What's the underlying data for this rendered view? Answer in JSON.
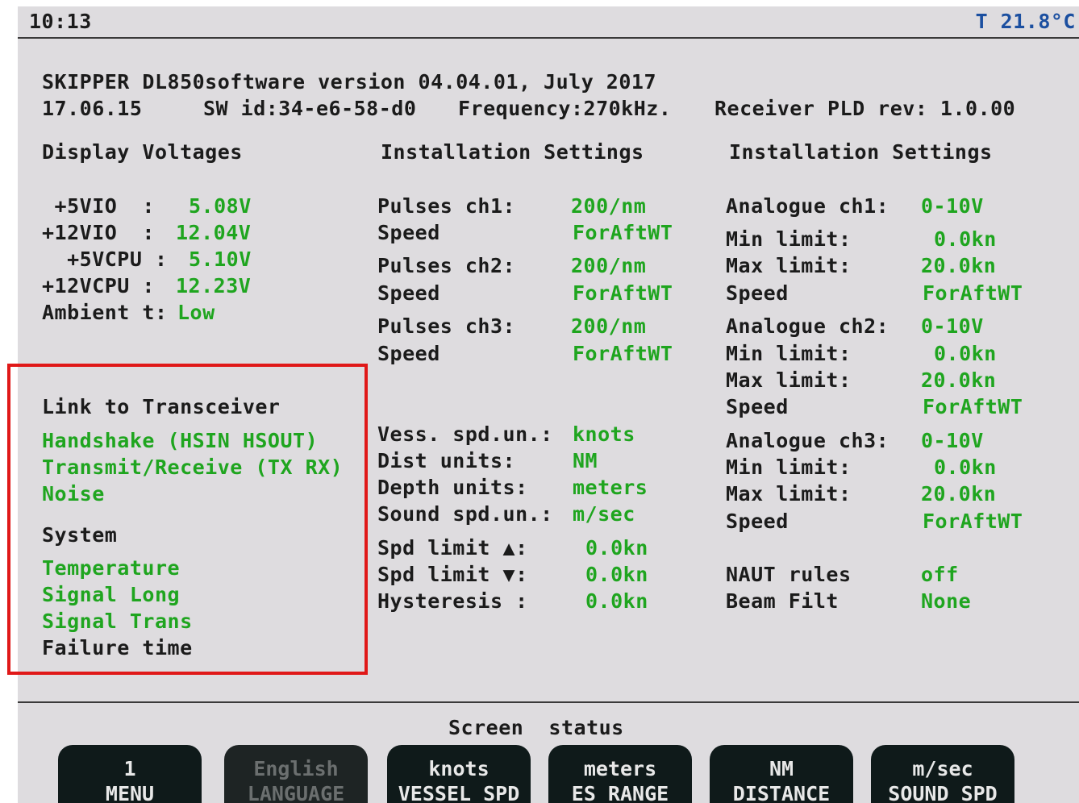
{
  "topbar": {
    "time": "10:13",
    "temperature": "T 21.8°C"
  },
  "header": {
    "line1": "SKIPPER DL850software version 04.04.01, July 2017",
    "line2_date": "17.06.15",
    "line2_swid": "SW id:34-e6-58-d0",
    "line2_freq": "Frequency:270kHz.",
    "line2_pld": "Receiver PLD rev: 1.0.00"
  },
  "voltages": {
    "title": "Display Voltages",
    "rows": [
      {
        "label": " +5VIO  :",
        "value": "5.08V"
      },
      {
        "label": "+12VIO  :",
        "value": "12.04V"
      },
      {
        "label": "  +5VCPU :",
        "value": "5.10V"
      },
      {
        "label": "+12VCPU :",
        "value": "12.23V"
      },
      {
        "label": "Ambient t:",
        "value": "Low"
      }
    ]
  },
  "link": {
    "title": "Link to Transceiver",
    "items": [
      "Handshake (HSIN HSOUT)",
      "Transmit/Receive (TX RX)",
      "Noise"
    ],
    "system_title": "System",
    "system_items": [
      "Temperature",
      "Signal Long",
      "Signal Trans"
    ],
    "failure": "Failure time"
  },
  "install1": {
    "title": "Installation Settings",
    "rows": [
      {
        "label": "Pulses ch1:",
        "value": "200/nm"
      },
      {
        "label": "Speed",
        "value": "ForAftWT"
      },
      {
        "label": "Pulses ch2:",
        "value": "200/nm"
      },
      {
        "label": "Speed",
        "value": "ForAftWT"
      },
      {
        "label": "Pulses ch3:",
        "value": "200/nm"
      },
      {
        "label": "Speed",
        "value": "ForAftWT"
      }
    ],
    "units": [
      {
        "label": "Vess. spd.un.:",
        "value": "knots"
      },
      {
        "label": "Dist units:",
        "value": "NM"
      },
      {
        "label": "Depth units:",
        "value": "meters"
      },
      {
        "label": "Sound spd.un.:",
        "value": "m/sec"
      }
    ],
    "limits": [
      {
        "label": "Spd limit ▲:",
        "value": "0.0kn"
      },
      {
        "label": "Spd limit ▼:",
        "value": "0.0kn"
      },
      {
        "label": "Hysteresis :",
        "value": "0.0kn"
      }
    ]
  },
  "install2": {
    "title": "Installation Settings",
    "rows": [
      {
        "label": "Analogue ch1:",
        "value": "0-10V"
      },
      {
        "label": "Min limit:",
        "value": "0.0kn"
      },
      {
        "label": "Max limit:",
        "value": "20.0kn"
      },
      {
        "label": "Speed",
        "value": "ForAftWT"
      },
      {
        "label": "Analogue ch2:",
        "value": "0-10V"
      },
      {
        "label": "Min limit:",
        "value": "0.0kn"
      },
      {
        "label": "Max limit:",
        "value": "20.0kn"
      },
      {
        "label": "Speed",
        "value": "ForAftWT"
      },
      {
        "label": "Analogue ch3:",
        "value": "0-10V"
      },
      {
        "label": "Min limit:",
        "value": "0.0kn"
      },
      {
        "label": "Max limit:",
        "value": "20.0kn"
      },
      {
        "label": "Speed",
        "value": "ForAftWT"
      }
    ],
    "extra": [
      {
        "label": "NAUT rules",
        "value": "off"
      },
      {
        "label": "Beam Filt",
        "value": "None"
      }
    ]
  },
  "status": {
    "label": "Screen  status"
  },
  "softkeys": [
    {
      "top": "1",
      "bottom": "MENU"
    },
    {
      "top": "English",
      "bottom": "LANGUAGE"
    },
    {
      "top": "knots",
      "bottom": "VESSEL SPD"
    },
    {
      "top": "meters",
      "bottom": "ES RANGE"
    },
    {
      "top": "NM",
      "bottom": "DISTANCE"
    },
    {
      "top": "m/sec",
      "bottom": "SOUND SPD"
    }
  ],
  "colors": {
    "green_value": "#1fa51f",
    "highlight_box": "#e01818",
    "screen_bg": "#dedcdf"
  }
}
